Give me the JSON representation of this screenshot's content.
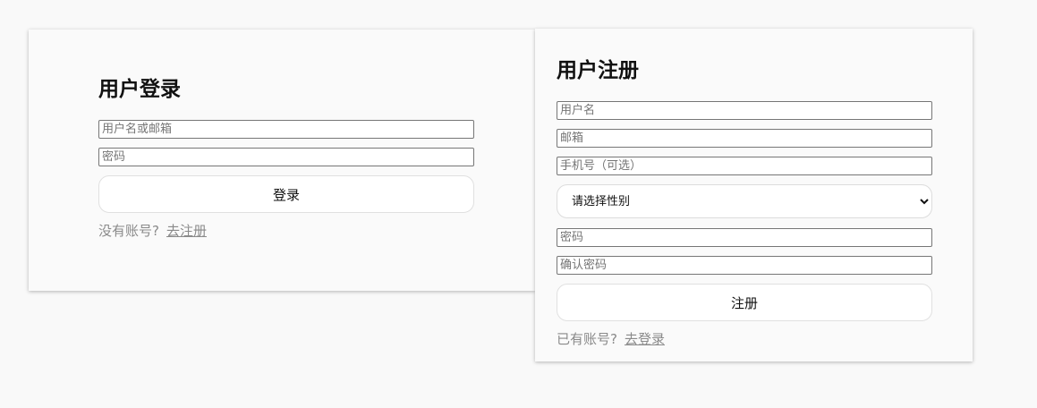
{
  "login": {
    "title": "用户登录",
    "username_placeholder": "用户名或邮箱",
    "password_placeholder": "密码",
    "submit_label": "登录",
    "switch_prompt": "没有账号?",
    "switch_link": "去注册"
  },
  "register": {
    "title": "用户注册",
    "username_placeholder": "用户名",
    "email_placeholder": "邮箱",
    "phone_placeholder": "手机号（可选）",
    "gender_selected": "请选择性别",
    "password_placeholder": "密码",
    "confirm_password_placeholder": "确认密码",
    "submit_label": "注册",
    "switch_prompt": "已有账号?",
    "switch_link": "去登录"
  }
}
